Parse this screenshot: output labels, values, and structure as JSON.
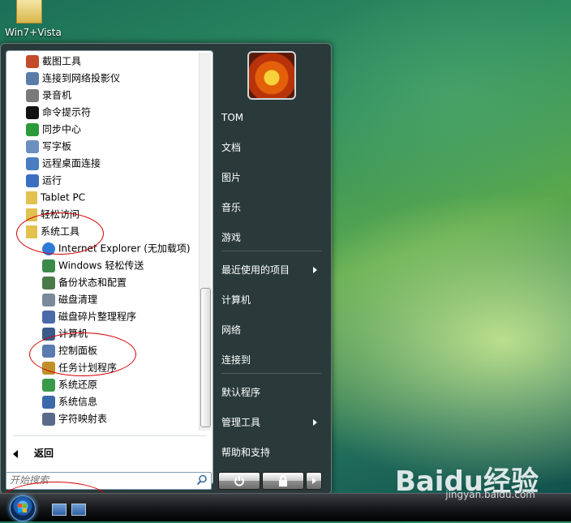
{
  "desktop": {
    "icon_label": "Win7+Vista"
  },
  "start_menu": {
    "programs": [
      {
        "label": "截图工具",
        "icon": "snipping-tool-icon",
        "color": "#c44a2a"
      },
      {
        "label": "连接到网络投影仪",
        "icon": "projector-icon",
        "color": "#5a7da8"
      },
      {
        "label": "录音机",
        "icon": "microphone-icon",
        "color": "#7a7a7a"
      },
      {
        "label": "命令提示符",
        "icon": "command-prompt-icon",
        "color": "#111111"
      },
      {
        "label": "同步中心",
        "icon": "sync-center-icon",
        "color": "#2a9a3a"
      },
      {
        "label": "写字板",
        "icon": "wordpad-icon",
        "color": "#6b8fbf"
      },
      {
        "label": "远程桌面连接",
        "icon": "remote-desktop-icon",
        "color": "#4a7ec0"
      },
      {
        "label": "运行",
        "icon": "run-icon",
        "color": "#3a6fbf"
      },
      {
        "label": "Tablet PC",
        "icon": "folder-icon",
        "color": "#e2c14f"
      },
      {
        "label": "轻松访问",
        "icon": "folder-icon",
        "color": "#e2c14f"
      },
      {
        "label": "系统工具",
        "icon": "folder-icon",
        "color": "#e2c14f"
      },
      {
        "label": "Internet Explorer (无加载项)",
        "icon": "internet-explorer-icon",
        "color": "#2f7ad8"
      },
      {
        "label": "Windows 轻松传送",
        "icon": "easy-transfer-icon",
        "color": "#3a8a4a"
      },
      {
        "label": "备份状态和配置",
        "icon": "backup-icon",
        "color": "#4a7a4a"
      },
      {
        "label": "磁盘清理",
        "icon": "disk-cleanup-icon",
        "color": "#7a8a9a"
      },
      {
        "label": "磁盘碎片整理程序",
        "icon": "defragmenter-icon",
        "color": "#4a6aaa"
      },
      {
        "label": "计算机",
        "icon": "computer-icon",
        "color": "#3a5a8a"
      },
      {
        "label": "控制面板",
        "icon": "control-panel-icon",
        "color": "#5a7ab0"
      },
      {
        "label": "任务计划程序",
        "icon": "task-scheduler-icon",
        "color": "#c0902a"
      },
      {
        "label": "系统还原",
        "icon": "system-restore-icon",
        "color": "#3a9a4a"
      },
      {
        "label": "系统信息",
        "icon": "system-info-icon",
        "color": "#3a6aaa"
      },
      {
        "label": "字符映射表",
        "icon": "character-map-icon",
        "color": "#5a6a8a"
      }
    ],
    "back_label": "返回",
    "search_placeholder": "开始搜索",
    "right_items": [
      {
        "label": "TOM",
        "has_arrow": false
      },
      {
        "label": "文档",
        "has_arrow": false
      },
      {
        "label": "图片",
        "has_arrow": false
      },
      {
        "label": "音乐",
        "has_arrow": false
      },
      {
        "label": "游戏",
        "has_arrow": false
      },
      {
        "label": "最近使用的项目",
        "has_arrow": true
      },
      {
        "label": "计算机",
        "has_arrow": false
      },
      {
        "label": "网络",
        "has_arrow": false
      },
      {
        "label": "连接到",
        "has_arrow": false
      },
      {
        "label": "默认程序",
        "has_arrow": false
      },
      {
        "label": "管理工具",
        "has_arrow": true
      },
      {
        "label": "帮助和支持",
        "has_arrow": false
      }
    ]
  },
  "watermark": {
    "brand": "Baidu经验",
    "url": "jingyan.baidu.com"
  },
  "colors": {
    "annotation_red": "#d40000",
    "menu_dark": "#2a3a3a"
  }
}
